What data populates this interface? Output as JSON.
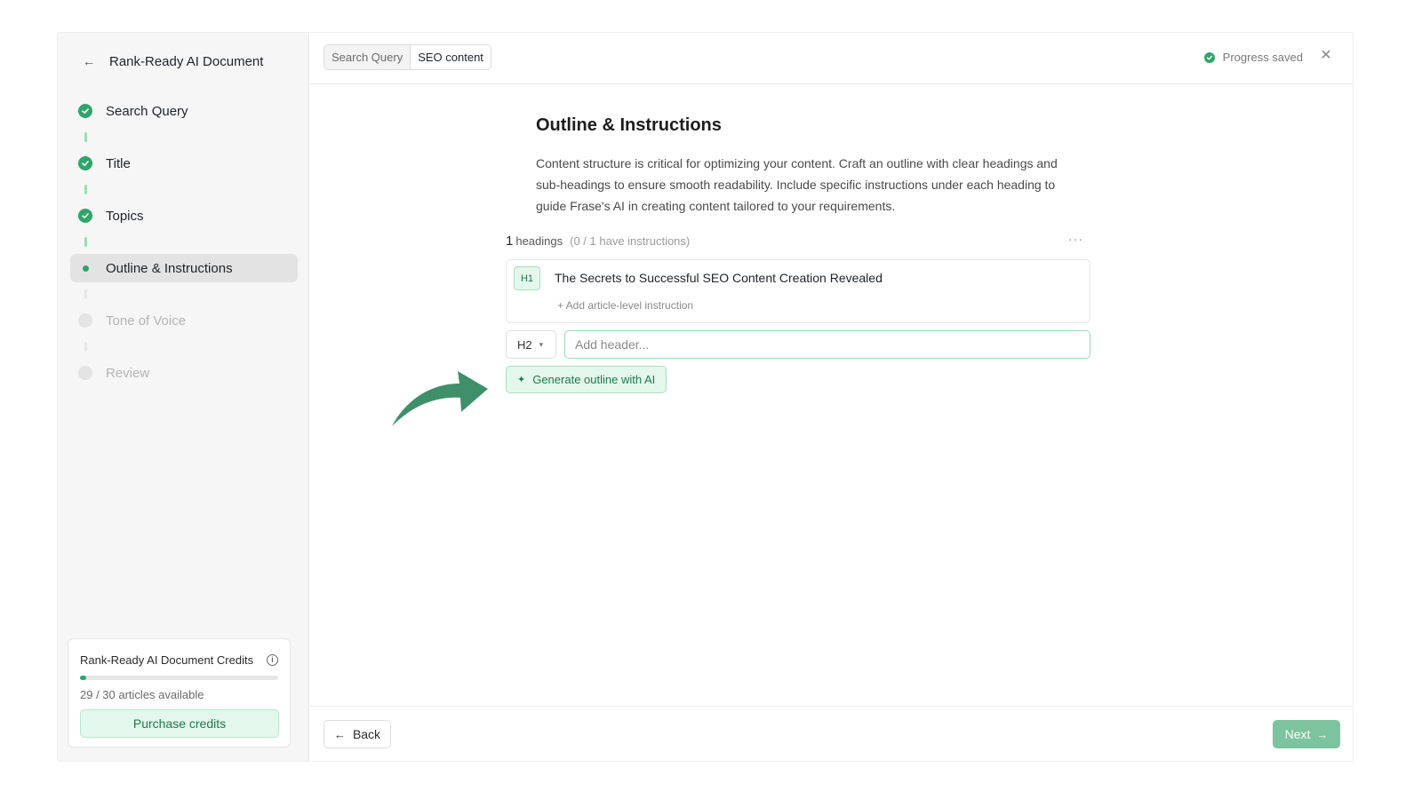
{
  "sidebar": {
    "doc_title": "Rank-Ready AI Document",
    "steps": [
      {
        "label": "Search Query",
        "state": "done"
      },
      {
        "label": "Title",
        "state": "done"
      },
      {
        "label": "Topics",
        "state": "done"
      },
      {
        "label": "Outline & Instructions",
        "state": "active"
      },
      {
        "label": "Tone of Voice",
        "state": "pending"
      },
      {
        "label": "Review",
        "state": "pending"
      }
    ],
    "credits": {
      "title": "Rank-Ready AI Document Credits",
      "info_icon": "info-icon",
      "used_fraction": 0.033,
      "available_text": "29 / 30 articles available",
      "purchase_label": "Purchase credits"
    }
  },
  "topbar": {
    "tabs": [
      {
        "label": "Search Query",
        "active": false
      },
      {
        "label": "SEO content",
        "active": true
      }
    ],
    "status": "Progress saved",
    "close_icon": "close-icon"
  },
  "main": {
    "heading": "Outline & Instructions",
    "description": "Content structure is critical for optimizing your content. Craft an outline with clear headings and sub-headings to ensure smooth readability. Include specific instructions under each heading to guide Frase's AI in creating content tailored to your requirements.",
    "headings_count": "1",
    "headings_label": "headings",
    "instructions_status": "(0 / 1 have instructions)",
    "h1_badge": "H1",
    "h1_text": "The Secrets to Successful SEO Content Creation Revealed",
    "add_instruction": "+ Add article-level instruction",
    "level_select": "H2",
    "header_placeholder": "Add header...",
    "generate_label": "Generate outline with AI"
  },
  "footer": {
    "back_label": "Back",
    "next_label": "Next"
  },
  "colors": {
    "accent": "#2fa56a",
    "accent_light": "#e4f7ec",
    "next_button": "#7bc49d",
    "arrow": "#3f8f6a"
  }
}
